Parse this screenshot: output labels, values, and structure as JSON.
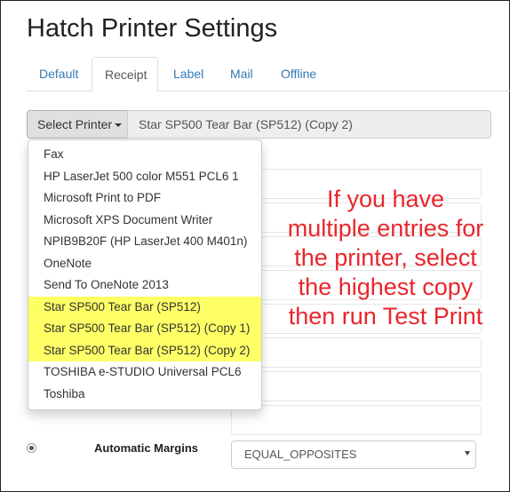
{
  "page_title": "Hatch Printer Settings",
  "tabs": [
    {
      "label": "Default"
    },
    {
      "label": "Receipt"
    },
    {
      "label": "Label"
    },
    {
      "label": "Mail"
    },
    {
      "label": "Offline"
    }
  ],
  "printer": {
    "select_button_label": "Select Printer",
    "selected_value": "Star SP500 Tear Bar (SP512) (Copy 2)"
  },
  "dropdown_items": [
    {
      "label": "Fax"
    },
    {
      "label": "HP LaserJet 500 color M551 PCL6 1"
    },
    {
      "label": "Microsoft Print to PDF"
    },
    {
      "label": "Microsoft XPS Document Writer"
    },
    {
      "label": "NPIB9B20F (HP LaserJet 400 M401n)"
    },
    {
      "label": "OneNote"
    },
    {
      "label": "Send To OneNote 2013"
    },
    {
      "label": "Star SP500 Tear Bar (SP512)"
    },
    {
      "label": "Star SP500 Tear Bar (SP512) (Copy 1)"
    },
    {
      "label": "Star SP500 Tear Bar (SP512) (Copy 2)"
    },
    {
      "label": "TOSHIBA e-STUDIO Universal PCL6"
    },
    {
      "label": "Toshiba"
    }
  ],
  "annotation": "If you have multiple entries for the printer, select the highest copy then run Test Print",
  "margins": {
    "label": "Automatic Margins",
    "value": "EQUAL_OPPOSITES"
  },
  "colors": {
    "highlight": "#ffff66",
    "annotation": "#e8262d",
    "link": "#337ab7"
  }
}
